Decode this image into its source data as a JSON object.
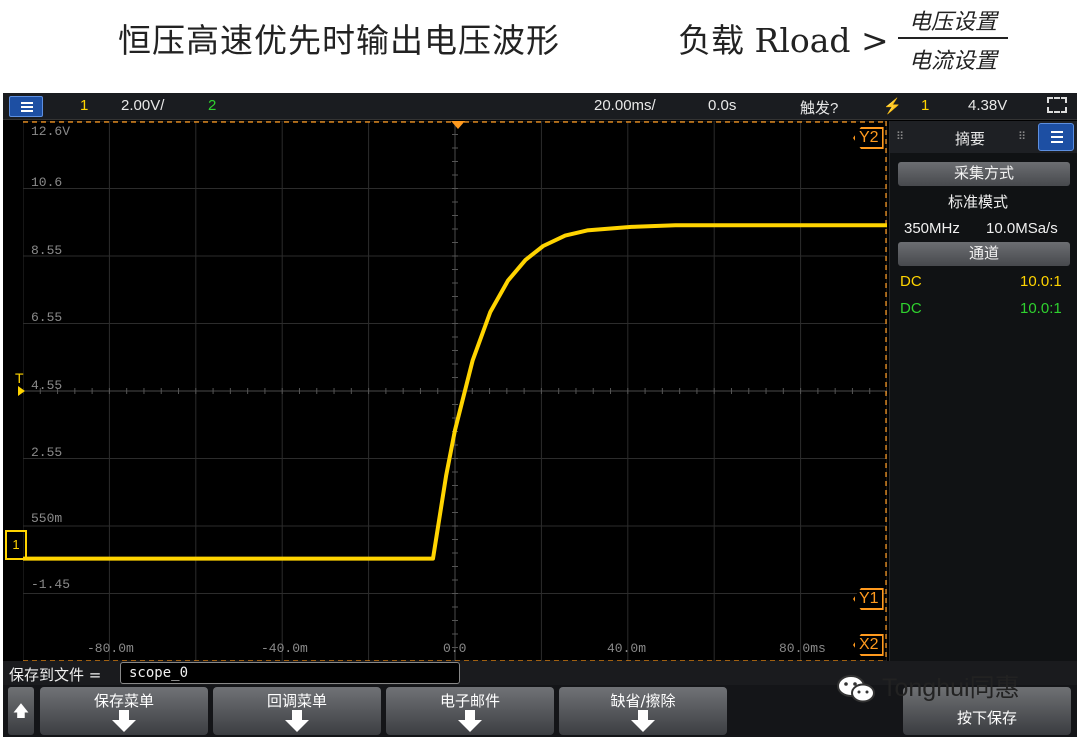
{
  "slide": {
    "title": "恒压高速优先时输出电压波形",
    "load_label": "负载 Rload >",
    "fraction_numerator": "电压设置",
    "fraction_denominator": "电流设置"
  },
  "topbar": {
    "ch1": "1",
    "ch1_scale": "2.00V/",
    "ch2": "2",
    "timebase": "20.00ms/",
    "delay": "0.0s",
    "trigger_status": "触发?",
    "trigger_source": "1",
    "trigger_level": "4.38V"
  },
  "grid": {
    "volt_labels": [
      "12.6V",
      "10.6",
      "8.55",
      "6.55",
      "4.55",
      "2.55",
      "550m",
      "-1.45"
    ],
    "time_labels": [
      "-80.0m",
      "-40.0m",
      "0.0",
      "40.0m",
      "80.0ms"
    ],
    "trigger_marker": "T",
    "ch1_marker": "1",
    "cursor_y2": "Y2",
    "cursor_y1": "Y1",
    "cursor_x2": "X2"
  },
  "panel": {
    "title": "摘要",
    "acq_button": "采集方式",
    "acq_mode": "标准模式",
    "bandwidth": "350MHz",
    "sample_rate": "10.0MSa/s",
    "channel_button": "通道",
    "ch1_coupling": "DC",
    "ch1_probe": "10.0:1",
    "ch2_coupling": "DC",
    "ch2_probe": "10.0:1"
  },
  "savebar": {
    "label": "保存到文件 =",
    "filename": "scope_0"
  },
  "softkeys": {
    "save_menu": "保存菜单",
    "recall_menu": "回调菜单",
    "email": "电子邮件",
    "default_erase": "缺省/擦除",
    "press_to_save": "按下保存"
  },
  "watermark": "Tonghui同惠",
  "colors": {
    "ch1": "#ffd400",
    "ch2": "#2fd12f",
    "cursor": "#ff9a1e",
    "accent_blue": "#1d4fa3"
  },
  "chart_data": {
    "type": "line",
    "title": "",
    "xlabel": "",
    "ylabel": "",
    "xlim": [
      -98,
      98
    ],
    "ylim": [
      -2.95,
      12.6
    ],
    "series": [
      {
        "x": [
          -98,
          -5,
          -4,
          -2,
          0,
          4,
          8,
          12,
          16,
          20,
          25,
          30,
          40,
          50,
          60,
          70,
          98
        ],
        "y": [
          0.0,
          0.0,
          0.8,
          2.4,
          3.7,
          5.7,
          7.1,
          8.0,
          8.6,
          9.0,
          9.3,
          9.45,
          9.55,
          9.6,
          9.6,
          9.6,
          9.6
        ]
      }
    ],
    "cursors": {
      "y1": -2.95,
      "y2": 12.6,
      "x2": 98
    }
  }
}
